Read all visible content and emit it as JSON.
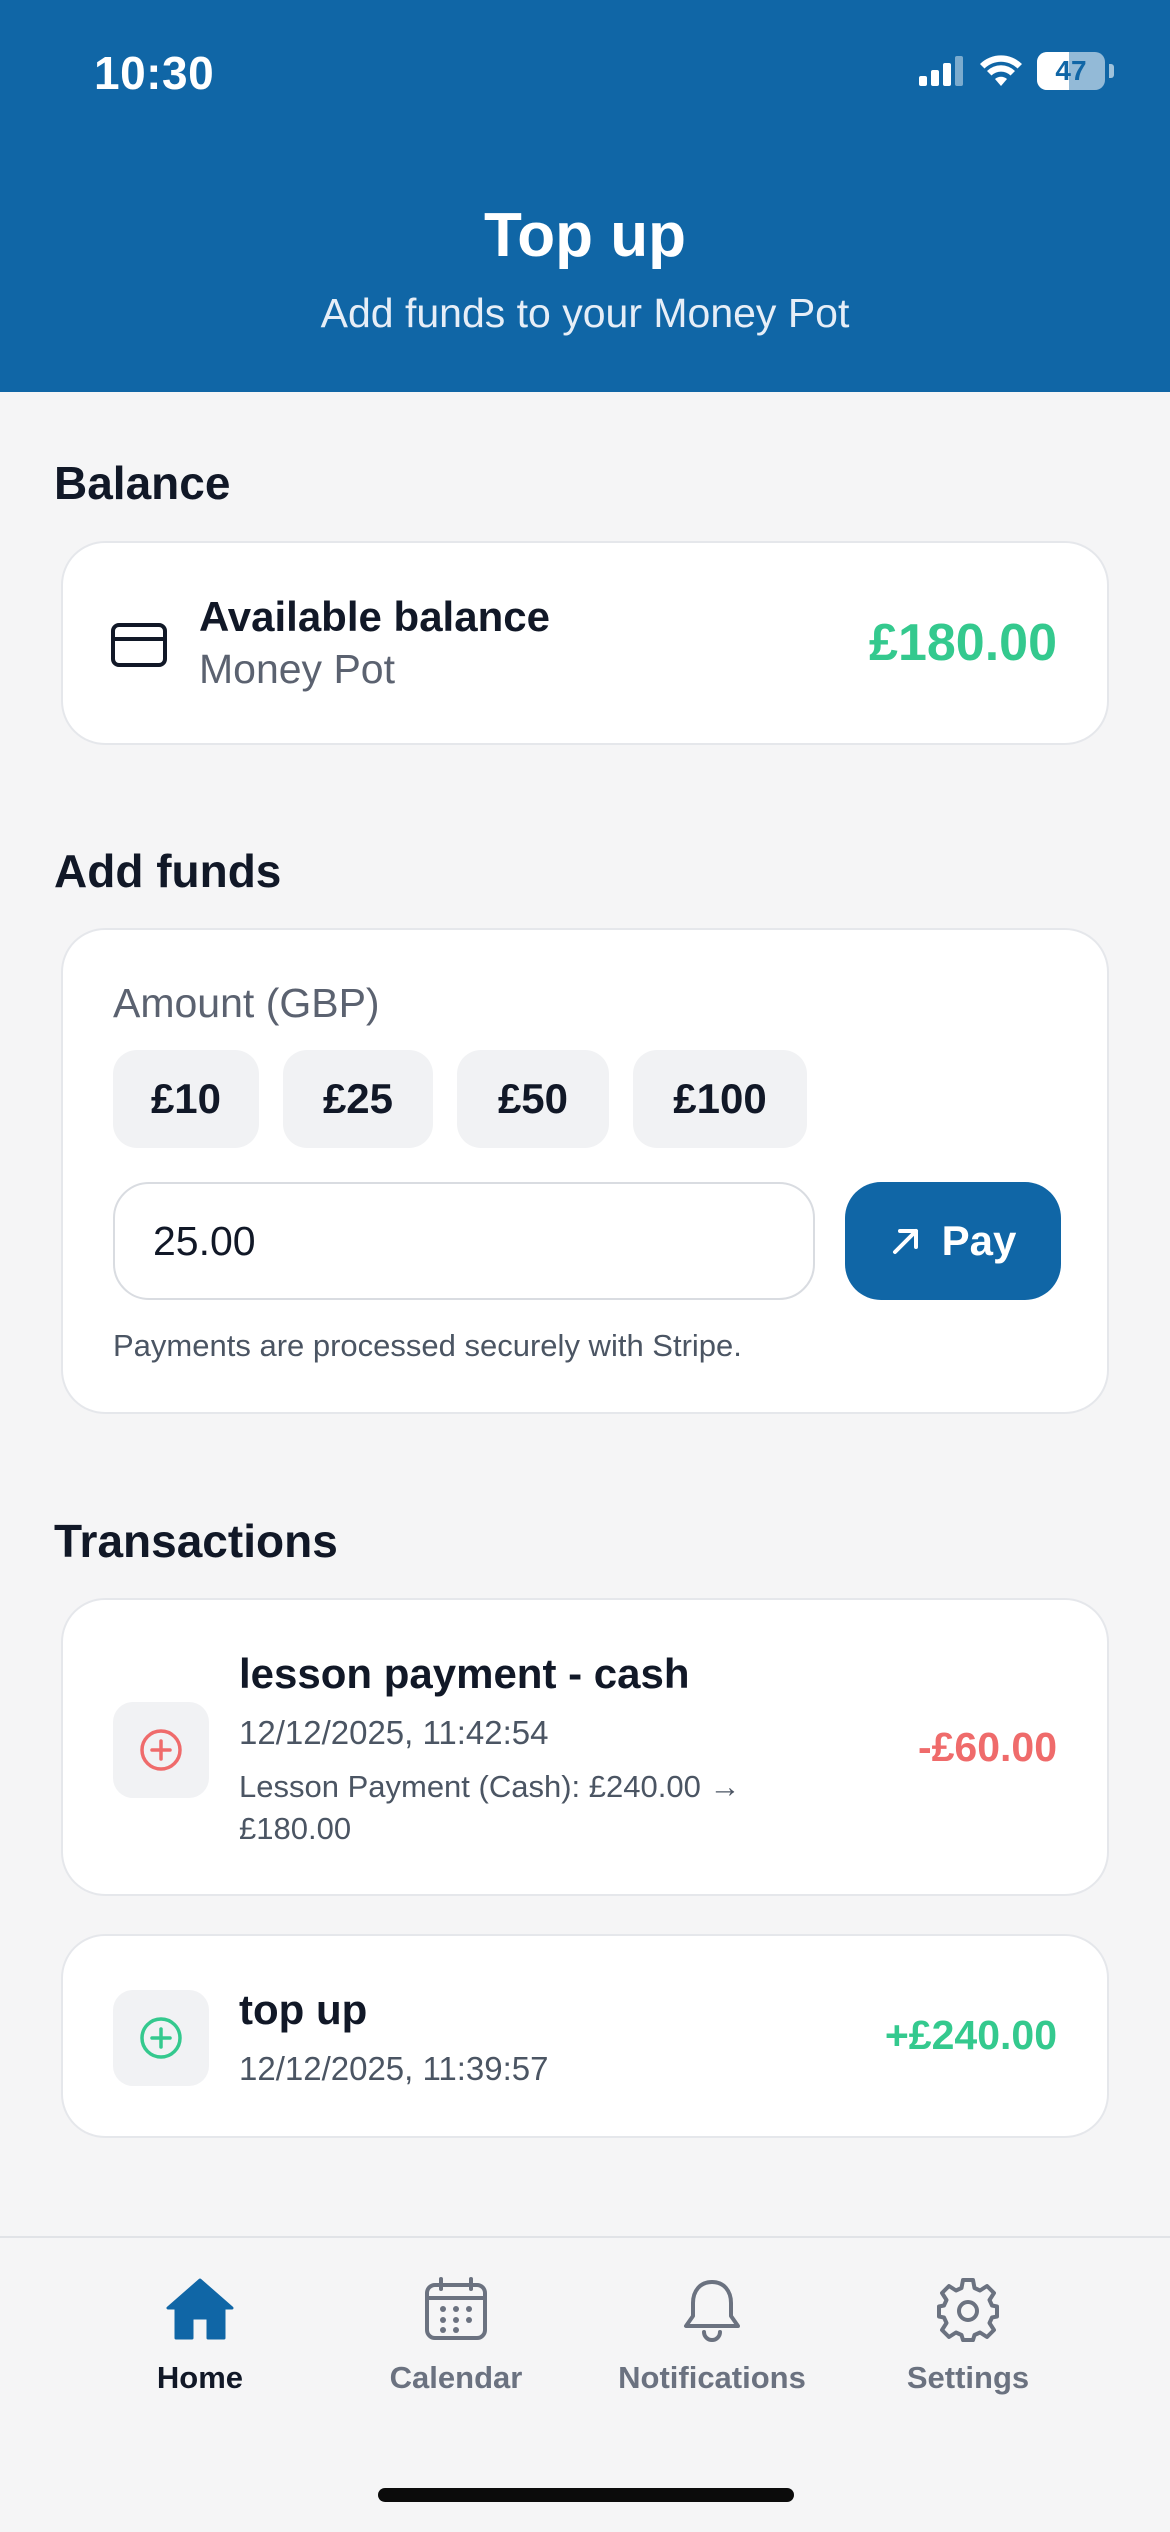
{
  "status_bar": {
    "time": "10:30",
    "battery": "47",
    "battery_level": 0.47
  },
  "header": {
    "title": "Top up",
    "subtitle": "Add funds to your Money Pot"
  },
  "balance_section": {
    "title": "Balance",
    "card": {
      "icon": "credit-card-icon",
      "title": "Available balance",
      "subtitle": "Money Pot",
      "amount": "£180.00"
    }
  },
  "add_funds_section": {
    "title": "Add funds",
    "amount_label": "Amount (GBP)",
    "chips": [
      "£10",
      "£25",
      "£50",
      "£100"
    ],
    "amount_value": "25.00",
    "pay_label": "Pay",
    "note": "Payments are processed securely with Stripe."
  },
  "transactions_section": {
    "title": "Transactions",
    "items": [
      {
        "icon": "plus-circle-icon",
        "title": "lesson payment - cash",
        "date": "12/12/2025, 11:42:54",
        "note": "Lesson Payment (Cash): £240.00 → £180.00",
        "amount": "-£60.00"
      },
      {
        "icon": "plus-circle-icon",
        "title": "top up",
        "date": "12/12/2025, 11:39:57",
        "amount": "+£240.00"
      }
    ]
  },
  "nav": [
    {
      "label": "Home",
      "icon": "home-icon",
      "active": true
    },
    {
      "label": "Calendar",
      "icon": "calendar-icon",
      "active": false
    },
    {
      "label": "Notifications",
      "icon": "bell-icon",
      "active": false
    },
    {
      "label": "Settings",
      "icon": "gear-icon",
      "active": false
    }
  ],
  "colors": {
    "brand": "#1066a6",
    "positive": "#34c98e",
    "negative": "#ef6b6b"
  }
}
